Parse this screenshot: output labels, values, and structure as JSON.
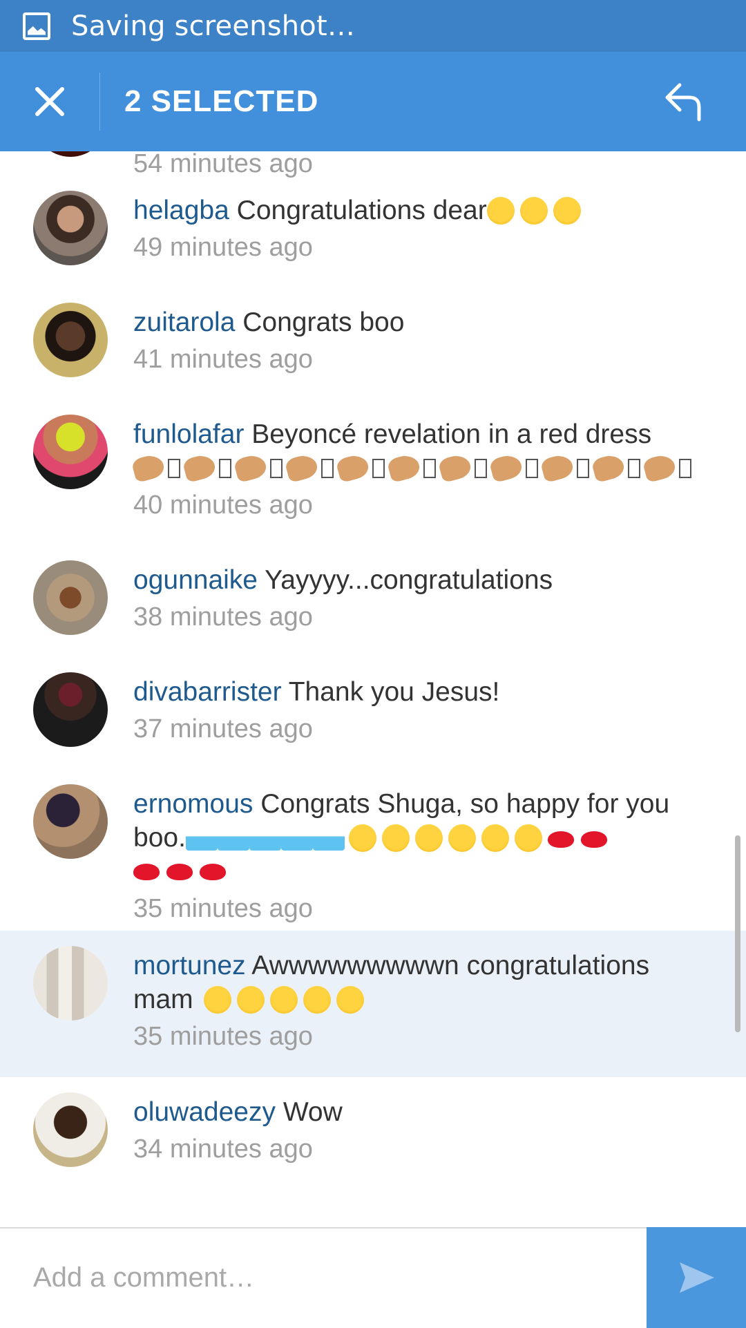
{
  "status_bar": {
    "text": "Saving screenshot…",
    "icon": "image-icon"
  },
  "action_bar": {
    "title": "2 SELECTED",
    "close_icon": "close-icon",
    "reply_icon": "reply-icon"
  },
  "comments": [
    {
      "username": "",
      "text": "",
      "time": "54 minutes ago",
      "selected": false
    },
    {
      "username": "helagba",
      "text": "Congratulations dear",
      "time": "49 minutes ago",
      "selected": false
    },
    {
      "username": "zuitarola",
      "text": "Congrats boo",
      "time": "41 minutes ago",
      "selected": false
    },
    {
      "username": "funlolafar",
      "text": "Beyoncé revelation in a red dress",
      "time": "40 minutes ago",
      "selected": false
    },
    {
      "username": "ogunnaike",
      "text": "Yayyyy...congratulations",
      "time": "38 minutes ago",
      "selected": false
    },
    {
      "username": "divabarrister",
      "text": "Thank you Jesus!",
      "time": "37 minutes ago",
      "selected": false
    },
    {
      "username": "ernomous",
      "text": "Congrats Shuga, so happy for you boo.",
      "time": "35 minutes ago",
      "selected": false
    },
    {
      "username": "mortunez",
      "text": "Awwwwwwwwwn congratulations mam",
      "time": "35 minutes ago",
      "selected": true
    },
    {
      "username": "oluwadeezy",
      "text": "Wow",
      "time": "34 minutes ago",
      "selected": false
    }
  ],
  "composer": {
    "placeholder": "Add a comment…",
    "send_icon": "send-icon"
  },
  "colors": {
    "status_bar": "#3d82c6",
    "action_bar": "#4290dc",
    "username": "#1e5a8e",
    "selected_row": "#eaf1f9",
    "send_button": "#4b97de"
  }
}
